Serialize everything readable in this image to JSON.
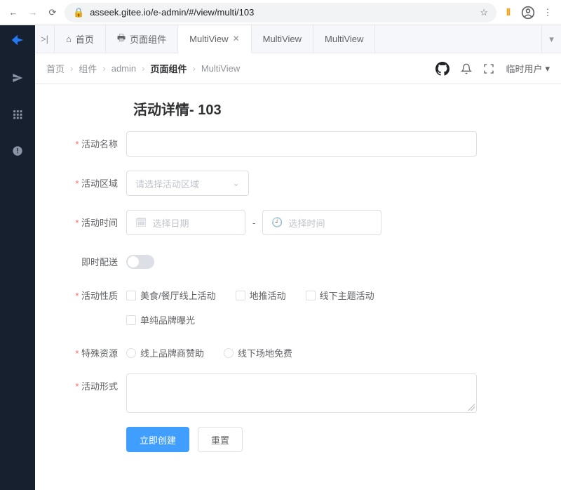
{
  "browser": {
    "url": "asseek.gitee.io/e-admin/#/view/multi/103"
  },
  "tabs": {
    "home": {
      "label": "首页"
    },
    "pageComp": {
      "label": "页面组件"
    },
    "multi1": {
      "label": "MultiView"
    },
    "multi2": {
      "label": "MultiView"
    },
    "multi3": {
      "label": "MultiView"
    }
  },
  "breadcrumbs": [
    "首页",
    "组件",
    "admin",
    "页面组件",
    "MultiView"
  ],
  "userLabel": "临时用户",
  "page": {
    "title": "活动详情- 103"
  },
  "form": {
    "name": {
      "label": "活动名称"
    },
    "region": {
      "label": "活动区域",
      "placeholder": "请选择活动区域"
    },
    "time": {
      "label": "活动时间",
      "datePlaceholder": "选择日期",
      "timePlaceholder": "选择时间"
    },
    "instant": {
      "label": "即时配送"
    },
    "nature": {
      "label": "活动性质",
      "options": [
        "美食/餐厅线上活动",
        "地推活动",
        "线下主题活动",
        "单纯品牌曝光"
      ]
    },
    "resource": {
      "label": "特殊资源",
      "options": [
        "线上品牌商赞助",
        "线下场地免费"
      ]
    },
    "format": {
      "label": "活动形式"
    },
    "buttons": {
      "submit": "立即创建",
      "reset": "重置"
    }
  }
}
